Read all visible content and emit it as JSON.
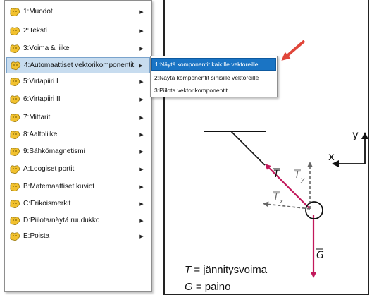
{
  "menu": {
    "items": [
      {
        "label": "1:Muodot"
      },
      {
        "label": "2:Teksti"
      },
      {
        "label": "3:Voima & liike"
      },
      {
        "label": "4:Automaattiset vektorikomponentit"
      },
      {
        "label": "5:Virtapiiri I"
      },
      {
        "label": "6:Virtapiiri II"
      },
      {
        "label": "7:Mittarit"
      },
      {
        "label": "8:Aaltoliike"
      },
      {
        "label": "9:Sähkömagnetismi"
      },
      {
        "label": "A:Loogiset portit"
      },
      {
        "label": "B:Matemaattiset kuviot"
      },
      {
        "label": "C:Erikoismerkit"
      },
      {
        "label": "D:Piilota/näytä ruudukko"
      },
      {
        "label": "E:Poista"
      }
    ],
    "active_index": 3
  },
  "submenu": {
    "items": [
      {
        "label": "1:Näytä komponentit kaikille vektoreille"
      },
      {
        "label": "2:Näytä komponentit sinisille vektoreille"
      },
      {
        "label": "3:Piilota vektorikomponentit"
      }
    ],
    "highlight_index": 0
  },
  "diagram": {
    "axis_x_label": "x",
    "axis_y_label": "y",
    "vector_T_label": "T",
    "component_Ty_label": "T",
    "component_Ty_sub": "y",
    "component_Tx_label": "T",
    "component_Tx_sub": "x",
    "vector_G_label": "G",
    "legend": [
      {
        "symbol": "T",
        "text": " = jännitysvoima"
      },
      {
        "symbol": "G",
        "text": " = paino"
      }
    ],
    "colors": {
      "vector": "#c2185b",
      "component": "#666666",
      "arrow_annotation": "#e0463a",
      "highlight": "#1a74c4"
    }
  }
}
